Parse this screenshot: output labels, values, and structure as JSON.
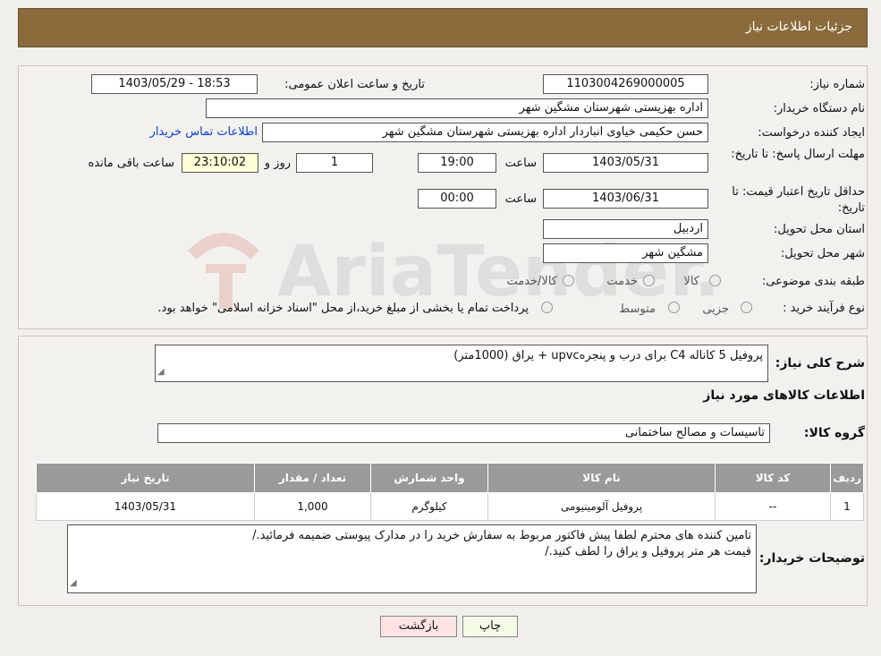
{
  "header": {
    "title": "جزئيات اطلاعات نياز"
  },
  "watermark": {
    "text": "AriaTender.neT"
  },
  "fields": {
    "need_number_label": "شماره نیاز:",
    "need_number": "1103004269000005",
    "announce_label": "تاریخ و ساعت اعلان عمومی:",
    "announce_value": "1403/05/29 - 18:53",
    "buyer_org_label": "نام دستگاه خریدار:",
    "buyer_org": "اداره بهزیستی شهرستان مشگین شهر",
    "creator_label": "ایجاد کننده درخواست:",
    "creator": "حسن حکیمی خیاوی انباردار اداره بهزیستی شهرستان مشگین شهر",
    "contact_link": "اطلاعات تماس خریدار",
    "deadline_label": "مهلت ارسال پاسخ: تا تاریخ:",
    "deadline_date": "1403/05/31",
    "time_word": "ساعت",
    "deadline_time": "19:00",
    "days": "1",
    "days_and": "روز و",
    "remaining": "23:10:02",
    "remaining_label": "ساعت باقی مانده",
    "validity_label": "حداقل تاریخ اعتبار قیمت: تا تاریخ:",
    "validity_date": "1403/06/31",
    "validity_time": "00:00",
    "province_label": "استان محل تحویل:",
    "province": "اردبیل",
    "city_label": "شهر محل تحویل:",
    "city": "مشگین شهر",
    "category_label": "طبقه بندی موضوعی:",
    "category_options": [
      "کالا",
      "خدمت",
      "کالا/خدمت"
    ],
    "process_label": "نوع فرآیند خرید :",
    "process_options": [
      "جزیی",
      "متوسط"
    ],
    "process_note": "پرداخت تمام یا بخشی از مبلغ خرید،از محل \"اسناد خزانه اسلامی\" خواهد بود."
  },
  "summary": {
    "desc_label": "شرح کلی نیاز:",
    "desc": "پروفیل 5 کاناله C4  برای درب و پنجرهupvc + یراق (1000متر)",
    "goods_heading": "اطلاعات کالاهای مورد نیاز",
    "group_label": "گروه کالا:",
    "group": "تاسیسات و مصالح ساختمانی"
  },
  "table": {
    "headers": [
      "ردیف",
      "کد کالا",
      "نام کالا",
      "واحد شمارش",
      "تعداد / مقدار",
      "تاریخ نیاز"
    ],
    "rows": [
      [
        "1",
        "--",
        "پروفیل آلومینیومی",
        "کیلوگرم",
        "1,000",
        "1403/05/31"
      ]
    ]
  },
  "notes": {
    "label": "توضیحات خریدار:",
    "line1": "تامین کننده های محترم لطفا پیش فاکتور مربوط به سفارش خرید را در مدارک پیوستی ضمیمه فرمائید./",
    "line2": "قیمت هر متر پروفیل و یراق را لطف کنید./"
  },
  "buttons": {
    "print": "چاپ",
    "back": "بازگشت"
  }
}
